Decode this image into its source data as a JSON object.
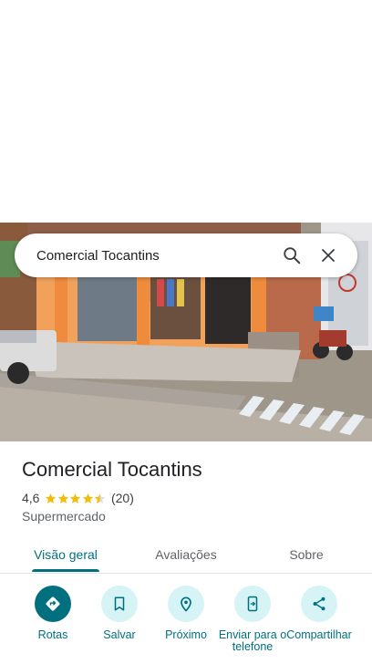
{
  "search": {
    "query": "Comercial Tocantins"
  },
  "place": {
    "name": "Comercial Tocantins",
    "rating": "4,6",
    "stars": 4.5,
    "review_count": "(20)",
    "category": "Supermercado"
  },
  "tabs": [
    {
      "label": "Visão geral",
      "active": true
    },
    {
      "label": "Avaliações",
      "active": false
    },
    {
      "label": "Sobre",
      "active": false
    }
  ],
  "actions": [
    {
      "label": "Rotas",
      "icon": "directions-icon"
    },
    {
      "label": "Salvar",
      "icon": "bookmark-icon"
    },
    {
      "label": "Próximo",
      "icon": "nearby-icon"
    },
    {
      "label": "Enviar para o telefone",
      "icon": "send-to-phone-icon"
    },
    {
      "label": "Compartilhar",
      "icon": "share-icon"
    }
  ],
  "colors": {
    "accent": "#00707f",
    "accent_light": "#d6f3f6",
    "star": "#f6bb06"
  }
}
